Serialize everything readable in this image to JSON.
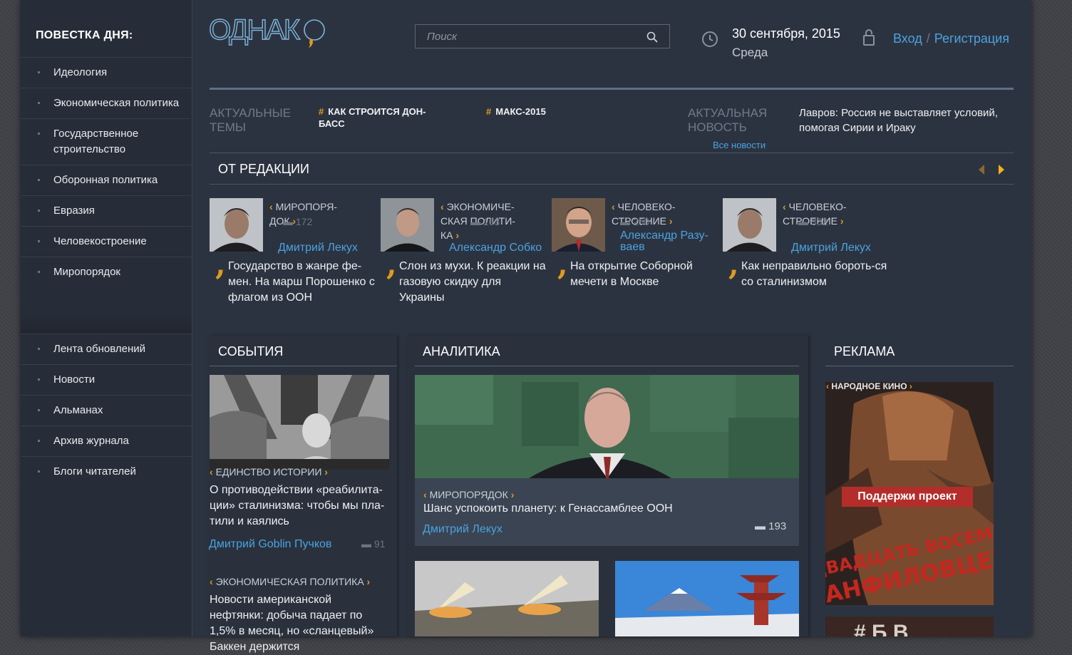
{
  "sidebar": {
    "title": "ПОВЕСТКА ДНЯ:",
    "items": [
      "Идеология",
      "Экономическая политика",
      "Государственное строительство",
      "Оборонная политика",
      "Евразия",
      "Человекостроение",
      "Миропорядок"
    ],
    "items2": [
      "Лента обновлений",
      "Новости",
      "Альманах",
      "Архив журнала",
      "Блоги читателей"
    ]
  },
  "header": {
    "logo_text": "ОДНАКО",
    "search_placeholder": "Поиск",
    "date": "30 сентября, 2015",
    "weekday": "Среда",
    "login": "Вход",
    "separator": "/",
    "register": "Регистрация"
  },
  "topics": {
    "label": "АКТУАЛЬНЫЕ ТЕМЫ",
    "tags": [
      "КАК СТРОИТСЯ ДОН-БАСС",
      "МАКС-2015"
    ],
    "hash": "#"
  },
  "news": {
    "label": "АКТУАЛЬНАЯ НОВОСТЬ",
    "all_link": "Все новости",
    "text": "Лавров: Россия не выставляет условий, помогая Сирии и Ираку"
  },
  "editorial": {
    "title": "ОТ РЕДАКЦИИ",
    "cards": [
      {
        "category": "МИРОПОРЯ-ДОК",
        "count": "172",
        "author": "Дмитрий Лекух",
        "title": "Государство в жанре фе-мен. На марш Порошенко с флагом из ООН"
      },
      {
        "category": "ЭКОНОМИЧЕ-СКАЯ ПОЛИТИ-КА",
        "count": "163",
        "author": "Александр Собко",
        "title": "Слон из мухи. К реакции на газовую скидку для Украины"
      },
      {
        "category": "ЧЕЛОВЕКО-СТРОЕНИЕ",
        "count": "250",
        "author": "Александр Разу-ваев",
        "title": "На открытие Соборной мечети в Москве"
      },
      {
        "category": "ЧЕЛОВЕКО-СТРОЕНИЕ",
        "count": "332",
        "author": "Дмитрий Лекух",
        "title": "Как неправильно бороть-ся со сталинизмом"
      }
    ]
  },
  "events": {
    "title": "СОБЫТИЯ",
    "items": [
      {
        "category": "ЕДИНСТВО ИСТОРИИ",
        "title": "О противодействии «реабилита-ции» сталинизма: чтобы мы пла-тили и каялись",
        "author": "Дмитрий Goblin Пучков",
        "count": "91"
      },
      {
        "category": "ЭКОНОМИЧЕСКАЯ ПОЛИТИКА",
        "title": "Новости американской нефтянки: добыча падает по 1,5% в месяц, но «сланцевый» Баккен держится"
      }
    ]
  },
  "analytics": {
    "title": "АНАЛИТИКА",
    "main": {
      "category": "МИРОПОРЯДОК",
      "title": "Шанс успокоить планету: к Генассамблее ООН",
      "author": "Дмитрий Лекух",
      "count": "193"
    }
  },
  "ads": {
    "title": "РЕКЛАМА",
    "tag": "НАРОДНОЕ КИНО",
    "button": "Поддержи проект",
    "poster_text": "ДВАДЦАТЬ ВОСЕМЬ ПАНФИЛОВЦЕВ",
    "poster2_text": "# Б В"
  },
  "colors": {
    "accent_blue": "#4aa3df",
    "accent_orange": "#e09a1e",
    "bg": "#2c3340",
    "sidebar": "#272d38"
  }
}
